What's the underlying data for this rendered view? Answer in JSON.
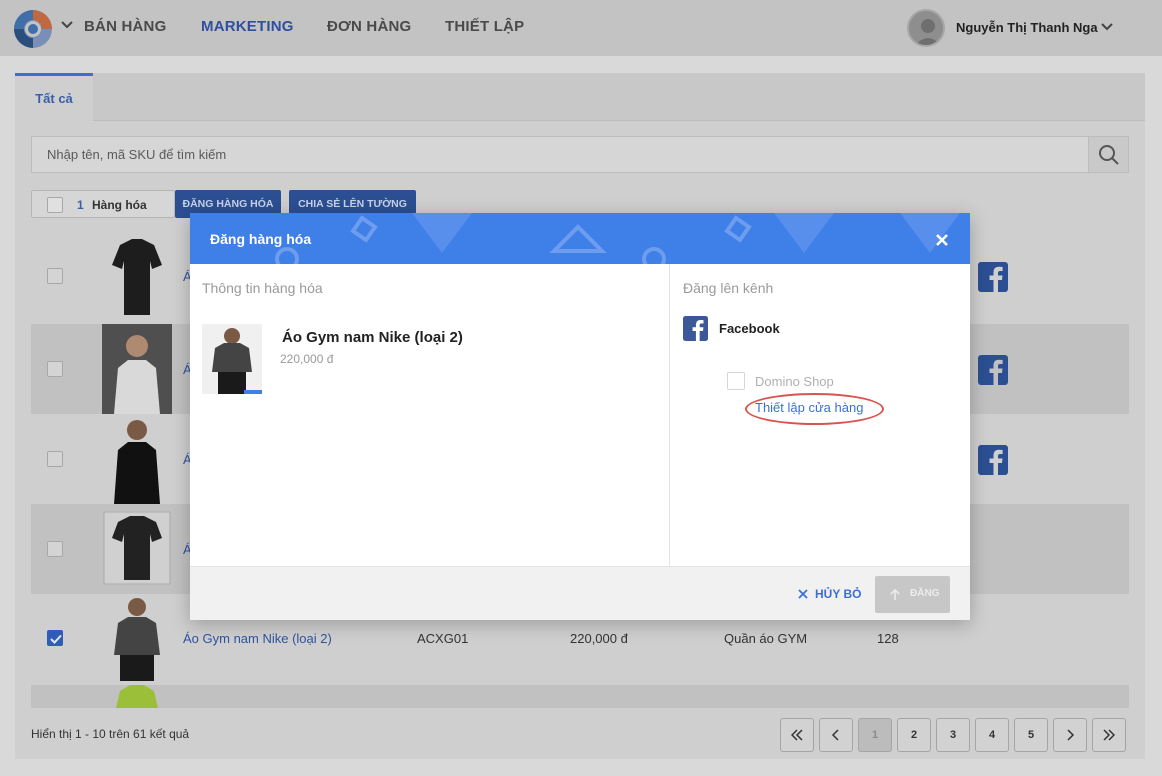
{
  "nav": {
    "items": [
      "BÁN HÀNG",
      "MARKETING",
      "ĐƠN HÀNG",
      "THIẾT LẬP"
    ],
    "active": "MARKETING",
    "user_name": "Nguyễn Thị Thanh Nga"
  },
  "tabs": {
    "all": "Tất cả"
  },
  "search": {
    "placeholder": "Nhập tên, mã SKU để tìm kiếm"
  },
  "toolbar": {
    "selected_count": "1",
    "selected_label": "Hàng hóa",
    "post_button": "ĐĂNG HÀNG HÓA",
    "share_button": "CHIA SẺ LÊN TƯỜNG"
  },
  "rows": [
    {
      "name": "Á",
      "checked": false,
      "facebook": true
    },
    {
      "name": "Á",
      "checked": false,
      "facebook": true
    },
    {
      "name": "Á",
      "checked": false,
      "facebook": true
    },
    {
      "name": "Á",
      "checked": false,
      "facebook": false
    },
    {
      "name": "Áo Gym nam Nike (loại 2)",
      "sku": "ACXG01",
      "price": "220,000 đ",
      "category": "Quần áo GYM",
      "stock": "128",
      "checked": true,
      "facebook": false
    }
  ],
  "footer": {
    "summary": "Hiển thị 1 - 10 trên 61 kết quả"
  },
  "pagination": {
    "pages": [
      "1",
      "2",
      "3",
      "4",
      "5"
    ],
    "current": "1"
  },
  "modal": {
    "title": "Đăng hàng hóa",
    "left_section_title": "Thông tin hàng hóa",
    "product_name": "Áo Gym nam Nike (loại 2)",
    "product_price": "220,000 đ",
    "right_section_title": "Đăng lên kênh",
    "channel": "Facebook",
    "shop_name": "Domino Shop",
    "setup_link": "Thiết lập cửa hàng",
    "cancel_label": "HỦY BỎ",
    "post_label": "ĐĂNG"
  },
  "colors": {
    "accent": "#3f7fe8",
    "brand_dark": "#2c4f93",
    "link": "#3a6fd6",
    "highlight_ring": "#d9534f"
  }
}
